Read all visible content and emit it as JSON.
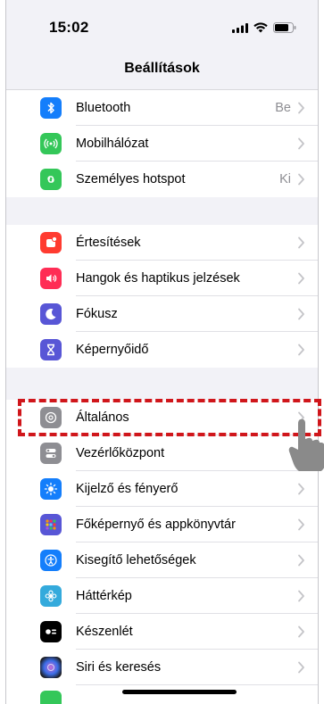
{
  "status_bar": {
    "time": "15:02"
  },
  "nav": {
    "title": "Beállítások"
  },
  "groups": [
    {
      "items": [
        {
          "label": "Bluetooth",
          "value": "Be",
          "icon": "bluetooth-icon",
          "color": "#147efb"
        },
        {
          "label": "Mobilhálózat",
          "value": "",
          "icon": "antenna-icon",
          "color": "#34c759"
        },
        {
          "label": "Személyes hotspot",
          "value": "Ki",
          "icon": "hotspot-icon",
          "color": "#34c759"
        }
      ]
    },
    {
      "items": [
        {
          "label": "Értesítések",
          "value": "",
          "icon": "notifications-icon",
          "color": "#ff3b30"
        },
        {
          "label": "Hangok és haptikus jelzések",
          "value": "",
          "icon": "speaker-icon",
          "color": "#ff2d55"
        },
        {
          "label": "Fókusz",
          "value": "",
          "icon": "moon-icon",
          "color": "#5856d6"
        },
        {
          "label": "Képernyőidő",
          "value": "",
          "icon": "hourglass-icon",
          "color": "#5856d6"
        }
      ]
    },
    {
      "items": [
        {
          "label": "Általános",
          "value": "",
          "icon": "gear-icon",
          "color": "#8e8e93"
        },
        {
          "label": "Vezérlőközpont",
          "value": "",
          "icon": "toggles-icon",
          "color": "#8e8e93"
        },
        {
          "label": "Kijelző és fényerő",
          "value": "",
          "icon": "sun-icon",
          "color": "#147efb"
        },
        {
          "label": "Főképernyő és appkönyvtár",
          "value": "",
          "icon": "app-grid-icon",
          "color": "#5856d6"
        },
        {
          "label": "Kisegítő lehetőségek",
          "value": "",
          "icon": "accessibility-icon",
          "color": "#147efb"
        },
        {
          "label": "Háttérkép",
          "value": "",
          "icon": "flower-icon",
          "color": "#34aadc"
        },
        {
          "label": "Készenlét",
          "value": "",
          "icon": "standby-icon",
          "color": "#000000"
        },
        {
          "label": "Siri és keresés",
          "value": "",
          "icon": "siri-icon",
          "color": "#1c1c1e"
        }
      ]
    }
  ],
  "highlight": {
    "color": "#d0161b",
    "target": "Általános"
  }
}
